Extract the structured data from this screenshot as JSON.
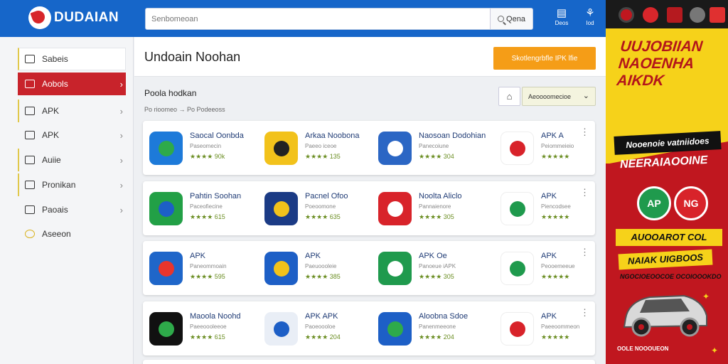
{
  "header": {
    "logo_title": "DUDAIAN",
    "logo_subtitle": "",
    "search_placeholder": "Senbomeoan",
    "search_button": "Qena",
    "icons": [
      {
        "name": "list-icon",
        "label": "Deos"
      },
      {
        "name": "share-icon",
        "label": "Iod"
      }
    ]
  },
  "sidebar": {
    "items": [
      {
        "label": "Sabeis",
        "icon": "folder-icon",
        "chevron": false
      },
      {
        "label": "Aobols",
        "icon": "briefcase-icon",
        "chevron": true,
        "active": true
      },
      {
        "label": "APK",
        "icon": "home-icon",
        "chevron": true
      },
      {
        "label": "APK",
        "icon": "gamepad-icon",
        "chevron": true
      },
      {
        "label": "Auiie",
        "icon": "document-icon",
        "chevron": true
      },
      {
        "label": "Pronikan",
        "icon": "grid-icon",
        "chevron": true
      },
      {
        "label": "Paoais",
        "icon": "box-icon",
        "chevron": true
      },
      {
        "label": "Aseeon",
        "icon": "star-icon",
        "chevron": false
      }
    ]
  },
  "main": {
    "title": "Undoain Noohan",
    "cta_label": "Skotlengrbfle IPK lfie",
    "section_title": "Poola hodkan",
    "section_sub": "Po rioomeo →  Po  Podeeoss",
    "filter_value": "Aeoooomecioe",
    "rows": [
      [
        {
          "name": "Saocal Oonbda",
          "dev": "Paseomecin",
          "rating": "★★★★ 90k",
          "color": "#1d7ad9",
          "accent": "#2eaa4a"
        },
        {
          "name": "Arkaa Noobona",
          "dev": "Paeeo iceoe",
          "rating": "★★★★ 135",
          "color": "#f2c21b",
          "accent": "#222"
        },
        {
          "name": "Naosoan Dodohian",
          "dev": "Panecoiune",
          "rating": "★★★★ 304",
          "color": "#2b66c4",
          "accent": "#fff"
        },
        {
          "name": "APK A",
          "dev": "Peiommeieio",
          "rating": "★★★★★",
          "color": "#ffffff",
          "accent": "#d8232a"
        }
      ],
      [
        {
          "name": "Pahtin Soohan",
          "dev": "Paceofiecine",
          "rating": "★★★★ 615",
          "color": "#22a046",
          "accent": "#1d5fc6"
        },
        {
          "name": "Pacnel Ofoo",
          "dev": "Poeoomone",
          "rating": "★★★★ 635",
          "color": "#1b3b85",
          "accent": "#f2c21b"
        },
        {
          "name": "Noolta Aliclo",
          "dev": "Pannaienore",
          "rating": "★★★★ 305",
          "color": "#d8232a",
          "accent": "#fff"
        },
        {
          "name": "APK",
          "dev": "Piencodsee",
          "rating": "★★★★★",
          "color": "#ffffff",
          "accent": "#1f9a4d"
        }
      ],
      [
        {
          "name": "APK",
          "dev": "Paneommoain",
          "rating": "★★★★ 595",
          "color": "#1f66c9",
          "accent": "#e8352c"
        },
        {
          "name": "APK",
          "dev": "Paeuoooleie",
          "rating": "★★★★ 385",
          "color": "#1d5fc6",
          "accent": "#f2c21b"
        },
        {
          "name": "APK Oe",
          "dev": "Panoeue iAPK",
          "rating": "★★★★ 305",
          "color": "#1f9a4d",
          "accent": "#fff"
        },
        {
          "name": "APK",
          "dev": "Peooemeeue",
          "rating": "★★★★★",
          "color": "#ffffff",
          "accent": "#1f9a4d"
        }
      ],
      [
        {
          "name": "Maoola Noohd",
          "dev": "Paeeoooleeoe",
          "rating": "★★★★ 615",
          "color": "#111111",
          "accent": "#2eaa4a"
        },
        {
          "name": "APK APK",
          "dev": "Paoeoooloe",
          "rating": "★★★★ 204",
          "color": "#e9eef6",
          "accent": "#1d5fc6"
        },
        {
          "name": "Aloobna Sdoe",
          "dev": "Panenmeeone",
          "rating": "★★★★ 204",
          "color": "#1d5fc6",
          "accent": "#2eaa4a"
        },
        {
          "name": "APK",
          "dev": "Paeeoommeon",
          "rating": "★★★★★",
          "color": "#ffffff",
          "accent": "#d8232a"
        }
      ]
    ]
  },
  "ad": {
    "headline": "UUJOBIIAN NAOENHA AIKDK",
    "banner1": "Nooenoie vatniidoes",
    "sub2": "NEERAIAOOINE",
    "badge1": "AP",
    "badge2": "NG",
    "sub3": "AUOOAROT COL",
    "sub4": "NAIAK UIGBOOS",
    "sub5": "NGOCIOEOOCOE OCOIOOOKDO",
    "foot": "OOLE NOOOUEON"
  },
  "colors": {
    "header_blue": "#1666c9",
    "active_red": "#c8232b",
    "cta_orange": "#f59d17",
    "ad_red": "#c0171f",
    "ad_yellow": "#f6d21a"
  }
}
